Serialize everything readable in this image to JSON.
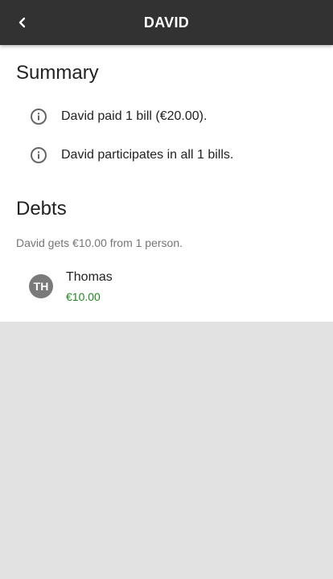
{
  "header": {
    "title": "DAVID",
    "back_icon": "chevron-left-icon"
  },
  "summary": {
    "title": "Summary",
    "items": [
      {
        "icon": "info-icon",
        "text": "David paid 1 bill (€20.00)."
      },
      {
        "icon": "info-icon",
        "text": "David participates in all 1 bills."
      }
    ]
  },
  "debts": {
    "title": "Debts",
    "summary_text": "David gets €10.00 from 1 person.",
    "items": [
      {
        "initials": "TH",
        "name": "Thomas",
        "amount": "€10.00",
        "amount_color": "#1e8a1e"
      }
    ]
  },
  "colors": {
    "topbar": "#323232",
    "background": "#e2e2e2",
    "avatar": "#7a7a7a",
    "positive_amount": "#1e8a1e"
  }
}
